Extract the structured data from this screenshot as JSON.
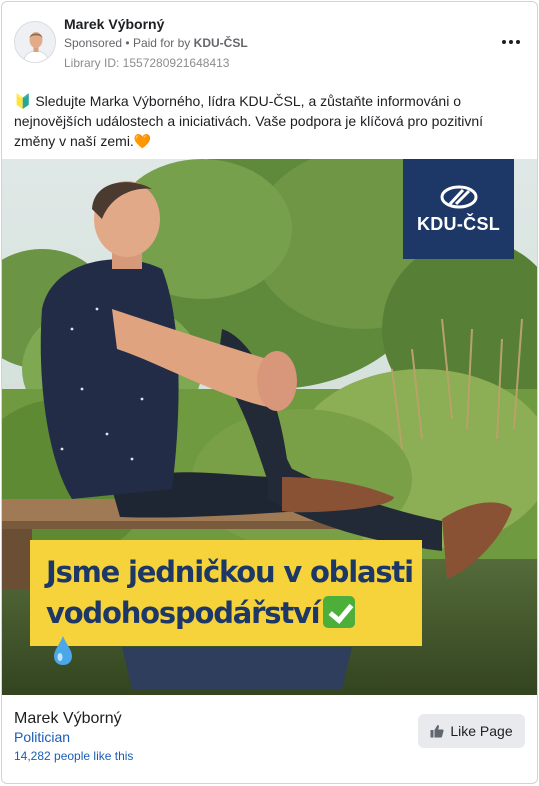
{
  "post": {
    "author": "Marek Výborný",
    "sponsored_label": "Sponsored",
    "separator": "•",
    "paid_for_label": "Paid for by",
    "paid_for_by": "KDU-ČSL",
    "library_id": "Library ID: 1557280921648413",
    "text": "🔰 Sledujte Marka Výborného, lídra KDU-ČSL, a zůstaňte informováni o nejnovějších událostech a iniciativách. Vaše podpora je klíčová pro pozitivní změny v naší zemi.🧡"
  },
  "media": {
    "logo_text": "KDU-ČSL",
    "banner_line1": "Jsme jedničkou v oblasti",
    "banner_line2": "vodohospodářství",
    "colors": {
      "logo_bg": "#1d3767",
      "banner_bg": "#f6d33a",
      "banner_text": "#1d3767"
    }
  },
  "footer": {
    "page_name": "Marek Výborný",
    "category": "Politician",
    "likes": "14,282 people like this",
    "like_button_label": "Like Page"
  },
  "icons": [
    "more-options-icon",
    "kdu-csl-logo",
    "checkmark-emoji-icon",
    "water-drop-icon",
    "thumbs-up-icon"
  ]
}
